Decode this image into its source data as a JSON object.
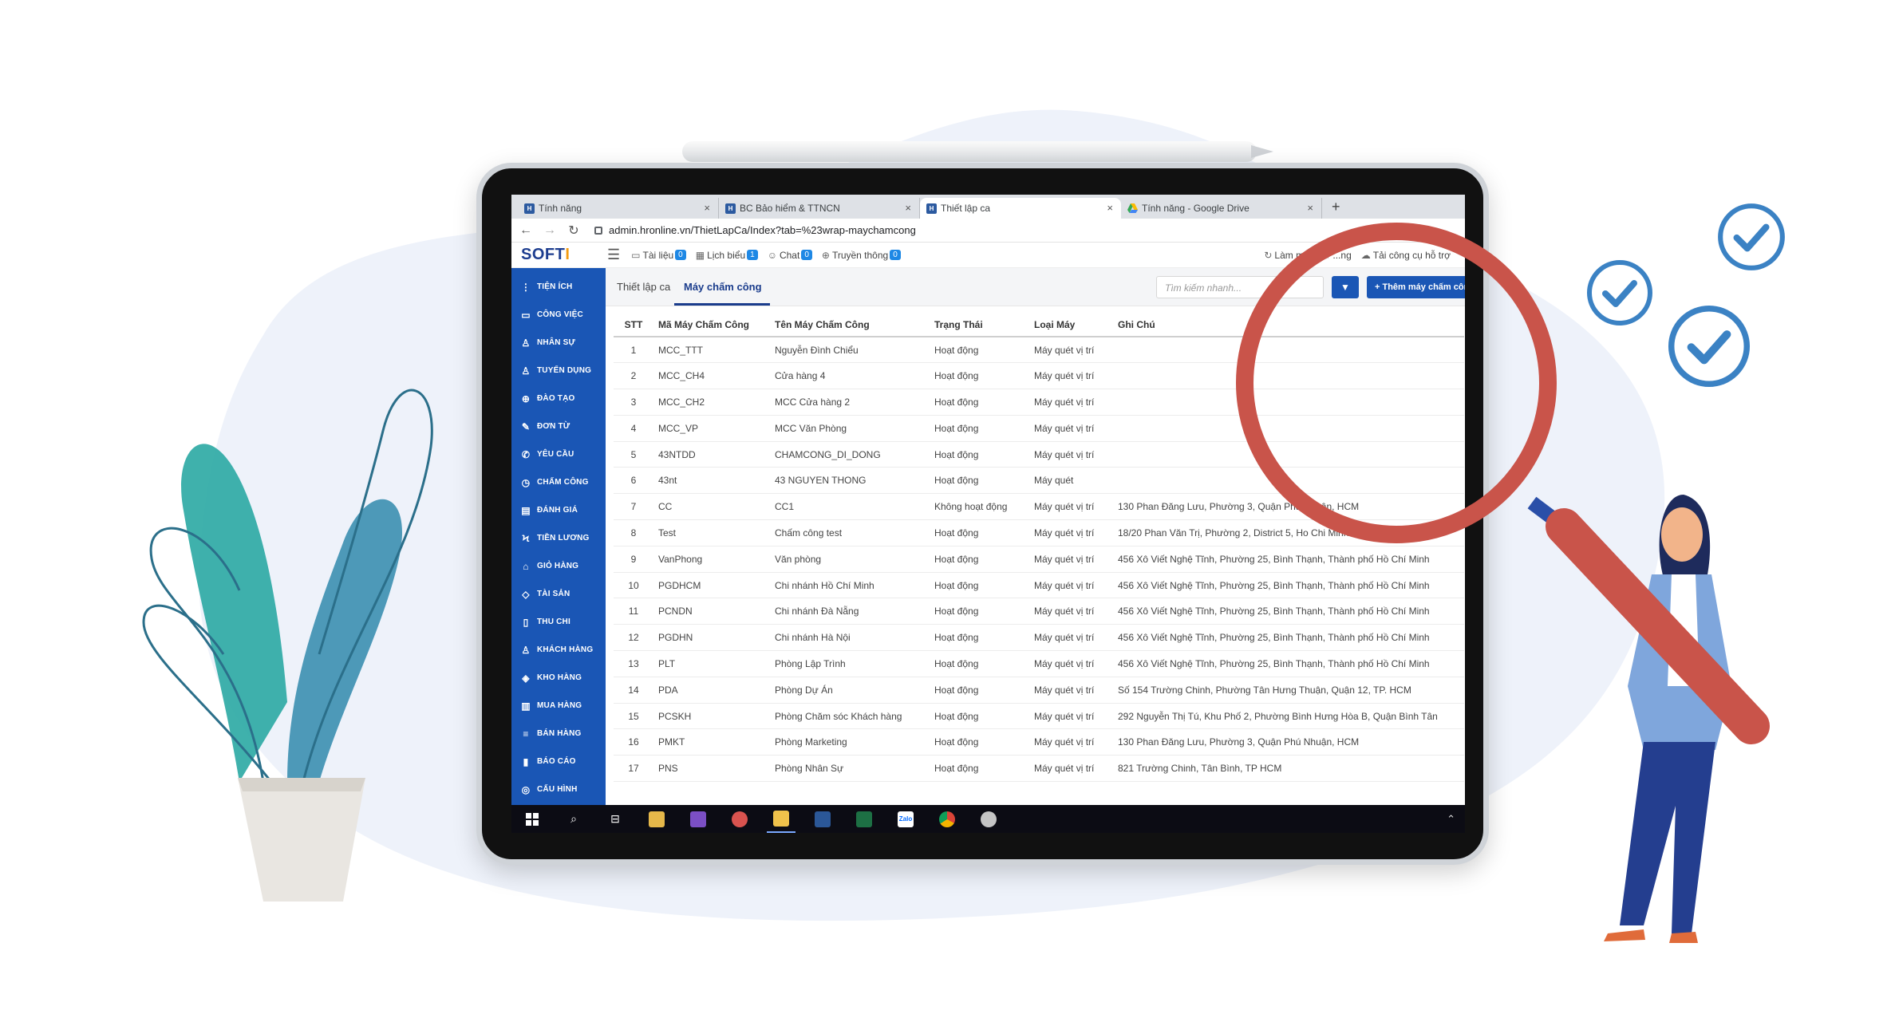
{
  "browser": {
    "tabs": [
      {
        "label": "Tính năng",
        "favicon": "hr-logo-icon",
        "active": false
      },
      {
        "label": "BC Bảo hiểm & TTNCN",
        "favicon": "hr-logo-icon",
        "active": false
      },
      {
        "label": "Thiết lập ca",
        "favicon": "hr-logo-icon",
        "active": true
      },
      {
        "label": "Tính năng - Google Drive",
        "favicon": "google-drive-icon",
        "active": false
      }
    ],
    "url": "admin.hronline.vn/ThietLapCa/Index?tab=%23wrap-maychamcong"
  },
  "header": {
    "logo": "SOFTI",
    "items": [
      {
        "label": "Tài liệu",
        "badge": "0",
        "icon": "folder-icon"
      },
      {
        "label": "Lịch biểu",
        "badge": "1",
        "icon": "calendar-icon"
      },
      {
        "label": "Chat",
        "badge": "0",
        "icon": "chat-icon"
      },
      {
        "label": "Truyền thông",
        "badge": "0",
        "icon": "globe-icon"
      }
    ],
    "right": [
      {
        "label": "Làm mới",
        "icon": "refresh-icon"
      },
      {
        "label": "...ng",
        "icon": "settings-icon"
      },
      {
        "label": "Tải công cụ hỗ trợ",
        "icon": "cloud-download-icon"
      }
    ]
  },
  "sidebar": {
    "items": [
      {
        "label": "Tiện ích",
        "icon": "more-icon"
      },
      {
        "label": "Công việc",
        "icon": "inbox-icon"
      },
      {
        "label": "Nhân sự",
        "icon": "user-icon"
      },
      {
        "label": "Tuyển dụng",
        "icon": "recruit-icon"
      },
      {
        "label": "Đào tạo",
        "icon": "plus-circle-icon"
      },
      {
        "label": "Đơn từ",
        "icon": "edit-icon"
      },
      {
        "label": "Yêu cầu",
        "icon": "phone-icon"
      },
      {
        "label": "Chấm công",
        "icon": "clock-icon"
      },
      {
        "label": "Đánh giá",
        "icon": "book-icon"
      },
      {
        "label": "Tiền lương",
        "icon": "bolt-icon"
      },
      {
        "label": "Giỏ hàng",
        "icon": "cart-icon"
      },
      {
        "label": "Tài sản",
        "icon": "diamond-icon"
      },
      {
        "label": "Thu chi",
        "icon": "file-icon"
      },
      {
        "label": "Khách hàng",
        "icon": "customer-icon"
      },
      {
        "label": "Kho hàng",
        "icon": "tag-icon"
      },
      {
        "label": "Mua hàng",
        "icon": "shop-icon"
      },
      {
        "label": "Bán hàng",
        "icon": "list-icon"
      },
      {
        "label": "Báo cáo",
        "icon": "chart-icon"
      },
      {
        "label": "Cấu hình",
        "icon": "layers-icon"
      }
    ]
  },
  "content": {
    "tabs": [
      "Thiết lập ca",
      "Máy chấm công"
    ],
    "active_tab": "Máy chấm công",
    "search_placeholder": "Tìm kiếm nhanh...",
    "add_button": "Thêm máy chấm công",
    "columns": [
      "STT",
      "Mã Máy Chấm Công",
      "Tên Máy Chấm Công",
      "Trạng Thái",
      "Loại Máy",
      "Ghi Chú"
    ],
    "rows": [
      [
        "1",
        "MCC_TTT",
        "Nguyễn Đình Chiểu",
        "Hoạt động",
        "Máy quét vị trí",
        ""
      ],
      [
        "2",
        "MCC_CH4",
        "Cửa hàng 4",
        "Hoạt động",
        "Máy quét vị trí",
        ""
      ],
      [
        "3",
        "MCC_CH2",
        "MCC Cửa hàng 2",
        "Hoạt động",
        "Máy quét vị trí",
        ""
      ],
      [
        "4",
        "MCC_VP",
        "MCC Văn Phòng",
        "Hoạt động",
        "Máy quét vị trí",
        ""
      ],
      [
        "5",
        "43NTDD",
        "CHAMCONG_DI_DONG",
        "Hoạt động",
        "Máy quét vị trí",
        ""
      ],
      [
        "6",
        "43nt",
        "43 NGUYEN THONG",
        "Hoạt động",
        "Máy quét",
        ""
      ],
      [
        "7",
        "CC",
        "CC1",
        "Không hoạt động",
        "Máy quét vị trí",
        "130 Phan Đăng Lưu, Phường 3, Quận Phú Nhuận, HCM"
      ],
      [
        "8",
        "Test",
        "Chấm công test",
        "Hoạt động",
        "Máy quét vị trí",
        "18/20 Phan Văn Trị, Phường 2, District 5, Ho Chi Minh City, Vietnam"
      ],
      [
        "9",
        "VanPhong",
        "Văn phòng",
        "Hoạt động",
        "Máy quét vị trí",
        "456 Xô Viết Nghệ Tĩnh, Phường 25, Bình Thạnh, Thành phố Hồ Chí Minh"
      ],
      [
        "10",
        "PGDHCM",
        "Chi nhánh Hồ Chí Minh",
        "Hoạt động",
        "Máy quét vị trí",
        "456 Xô Viết Nghệ Tĩnh, Phường 25, Bình Thạnh, Thành phố Hồ Chí Minh"
      ],
      [
        "11",
        "PCNDN",
        "Chi nhánh Đà Nẵng",
        "Hoạt động",
        "Máy quét vị trí",
        "456 Xô Viết Nghệ Tĩnh, Phường 25, Bình Thạnh, Thành phố Hồ Chí Minh"
      ],
      [
        "12",
        "PGDHN",
        "Chi nhánh Hà Nội",
        "Hoạt động",
        "Máy quét vị trí",
        "456 Xô Viết Nghệ Tĩnh, Phường 25, Bình Thạnh, Thành phố Hồ Chí Minh"
      ],
      [
        "13",
        "PLT",
        "Phòng Lập Trình",
        "Hoạt động",
        "Máy quét vị trí",
        "456 Xô Viết Nghệ Tĩnh, Phường 25, Bình Thạnh, Thành phố Hồ Chí Minh"
      ],
      [
        "14",
        "PDA",
        "Phòng Dự Án",
        "Hoạt động",
        "Máy quét vị trí",
        "Số 154 Trường Chinh, Phường Tân Hưng Thuận, Quận 12, TP. HCM"
      ],
      [
        "15",
        "PCSKH",
        "Phòng Chăm sóc Khách hàng",
        "Hoạt động",
        "Máy quét vị trí",
        "292 Nguyễn Thị Tú, Khu Phố 2, Phường Bình Hưng Hòa B, Quận Bình Tân"
      ],
      [
        "16",
        "PMKT",
        "Phòng Marketing",
        "Hoạt động",
        "Máy quét vị trí",
        "130 Phan Đăng Lưu, Phường 3, Quận Phú Nhuận, HCM"
      ],
      [
        "17",
        "PNS",
        "Phòng Nhân Sự",
        "Hoạt động",
        "Máy quét vị trí",
        "821 Trường Chinh, Tân Bình, TP HCM"
      ]
    ]
  },
  "taskbar": {
    "apps": [
      "windows-start-icon",
      "search-icon",
      "task-view-icon",
      "tools-icon",
      "visual-studio-icon",
      "paint-icon",
      "file-explorer-icon",
      "word-icon",
      "excel-icon",
      "zalo-icon",
      "chrome-icon",
      "paint-palette-icon"
    ],
    "zalo_label": "Zalo"
  },
  "colors": {
    "primary": "#1a56b5",
    "magnifier": "#c9544a",
    "check": "#3b82c4",
    "blob": "#eef2fa",
    "plant": "#2aa8a3"
  }
}
